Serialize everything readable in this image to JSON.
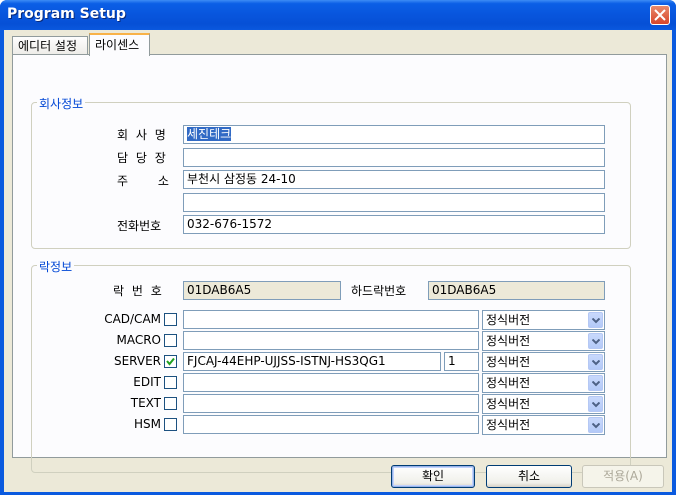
{
  "window": {
    "title": "Program Setup"
  },
  "tabs": [
    {
      "label": "에디터 설정"
    },
    {
      "label": "라이센스"
    }
  ],
  "company": {
    "group_label": "회사정보",
    "name_label": "회 사 명",
    "name_value": "세진테크",
    "manager_label": "담 당 장",
    "manager_value": "",
    "address_label": "주 소",
    "address_value": "부천시 삼정동 24-10",
    "address2_value": "",
    "phone_label": "전화번호",
    "phone_value": "032-676-1572"
  },
  "lock": {
    "group_label": "락정보",
    "lock_no_label": "락 번 호",
    "lock_no_value": "01DAB6A5",
    "hw_lock_label": "하드락번호",
    "hw_lock_value": "01DAB6A5"
  },
  "licenses": [
    {
      "name": "CAD/CAM",
      "checked": false,
      "key": "",
      "count": null,
      "edition": "정식버전"
    },
    {
      "name": "MACRO",
      "checked": false,
      "key": "",
      "count": null,
      "edition": "정식버전"
    },
    {
      "name": "SERVER",
      "checked": true,
      "key": "FJCAJ-44EHP-UJJSS-ISTNJ-HS3QG1",
      "count": "1",
      "edition": "정식버전"
    },
    {
      "name": "EDIT",
      "checked": false,
      "key": "",
      "count": null,
      "edition": "정식버전"
    },
    {
      "name": "TEXT",
      "checked": false,
      "key": "",
      "count": null,
      "edition": "정식버전"
    },
    {
      "name": "HSM",
      "checked": false,
      "key": "",
      "count": null,
      "edition": "정식버전"
    }
  ],
  "buttons": {
    "ok": "확인",
    "cancel": "취소",
    "apply": "적용(A)"
  },
  "colors": {
    "titlebar": "#0855dd",
    "group_label": "#0046d5",
    "selection": "#316ac5"
  },
  "icons": {
    "close": "close-icon",
    "checkbox": "checkmark-icon",
    "combo": "chevron-down-icon"
  }
}
